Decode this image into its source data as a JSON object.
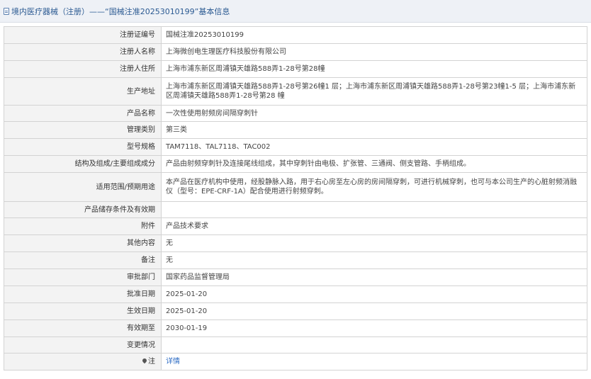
{
  "header": {
    "title": "境内医疗器械（注册）——“国械注准20253010199”基本信息"
  },
  "rows": [
    {
      "label": "注册证编号",
      "value": "国械注准20253010199"
    },
    {
      "label": "注册人名称",
      "value": "上海微创电生理医疗科技股份有限公司"
    },
    {
      "label": "注册人住所",
      "value": "上海市浦东新区周浦镇天雄路588弄1-28号第28幢"
    },
    {
      "label": "生产地址",
      "value": "上海市浦东新区周浦镇天雄路588弄1-28号第26幢1 层；上海市浦东新区周浦镇天雄路588弄1-28号第23幢1-5 层；上海市浦东新区周浦镇天雄路588弄1-28号第28 幢"
    },
    {
      "label": "产品名称",
      "value": "一次性使用射频房间隔穿刺针"
    },
    {
      "label": "管理类别",
      "value": "第三类"
    },
    {
      "label": "型号规格",
      "value": "TAM7118、TAL7118、TAC002"
    },
    {
      "label": "结构及组成/主要组成成分",
      "value": "产品由射频穿刺针及连接尾线组成，其中穿刺针由电极、扩张管、三通阀、侧支管路、手柄组成。"
    },
    {
      "label": "适用范围/预期用途",
      "value": "本产品在医疗机构中使用，经股静脉入路，用于右心房至左心房的房间隔穿刺，可进行机械穿刺，也可与本公司生产的心脏射频消融仪（型号：EPE-CRF-1A）配合使用进行射频穿刺。"
    },
    {
      "label": "产品储存条件及有效期",
      "value": ""
    },
    {
      "label": "附件",
      "value": "产品技术要求"
    },
    {
      "label": "其他内容",
      "value": "无"
    },
    {
      "label": "备注",
      "value": "无"
    },
    {
      "label": "审批部门",
      "value": "国家药品监督管理局"
    },
    {
      "label": "批准日期",
      "value": "2025-01-20"
    },
    {
      "label": "生效日期",
      "value": "2025-01-20"
    },
    {
      "label": "有效期至",
      "value": "2030-01-19"
    },
    {
      "label": "变更情况",
      "value": ""
    },
    {
      "label": "注",
      "value": "详情"
    }
  ]
}
